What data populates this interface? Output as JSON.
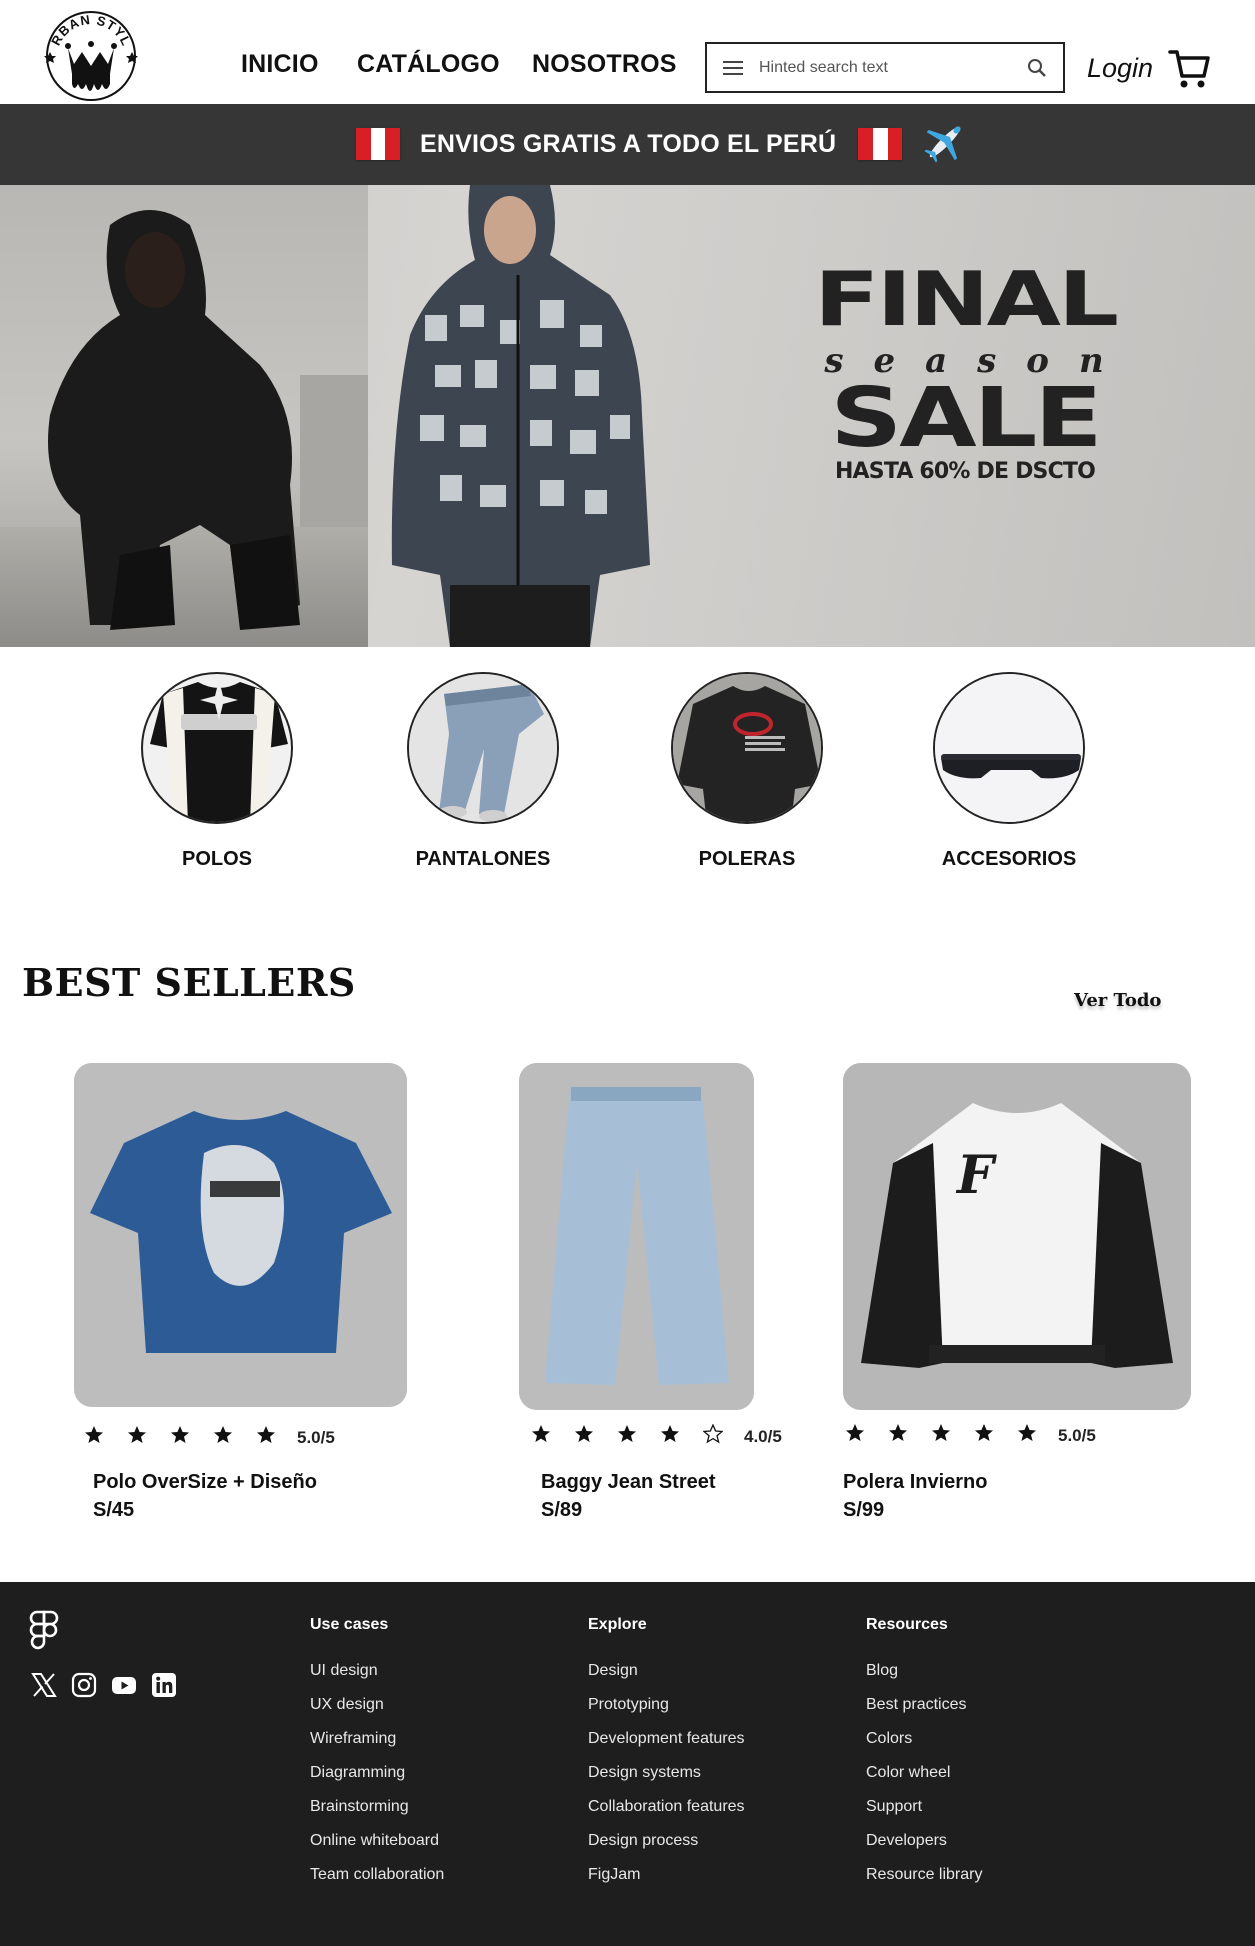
{
  "brand": {
    "logo_text": "URBAN STYLE"
  },
  "nav": {
    "items": [
      "INICIO",
      "CATÁLOGO",
      "NOSOTROS"
    ]
  },
  "search": {
    "placeholder": "Hinted search text",
    "value": ""
  },
  "header": {
    "login_label": "Login"
  },
  "promo": {
    "text": "ENVIOS GRATIS A TODO EL PERÚ"
  },
  "hero": {
    "line1": "FINAL",
    "line2": "season",
    "line3": "SALE",
    "line4": "HASTA 60% DE DSCTO"
  },
  "categories": [
    {
      "label": "POLOS"
    },
    {
      "label": "PANTALONES"
    },
    {
      "label": "POLERAS"
    },
    {
      "label": "ACCESORIOS"
    }
  ],
  "best_sellers": {
    "title": "BEST SELLERS",
    "view_all": "Ver Todo",
    "products": [
      {
        "name": "Polo OverSize + Diseño",
        "price": "S/45",
        "rating_text": "5.0/5",
        "rating": 5
      },
      {
        "name": "Baggy Jean Street",
        "price": "S/89",
        "rating_text": "4.0/5",
        "rating": 4
      },
      {
        "name": "Polera Invierno",
        "price": "S/99",
        "rating_text": "5.0/5",
        "rating": 5
      }
    ]
  },
  "footer": {
    "columns": [
      {
        "title": "Use cases",
        "links": [
          "UI design",
          "UX design",
          "Wireframing",
          "Diagramming",
          "Brainstorming",
          "Online whiteboard",
          "Team collaboration"
        ]
      },
      {
        "title": "Explore",
        "links": [
          "Design",
          "Prototyping",
          "Development features",
          "Design systems",
          "Collaboration features",
          "Design process",
          "FigJam"
        ]
      },
      {
        "title": "Resources",
        "links": [
          "Blog",
          "Best practices",
          "Colors",
          "Color wheel",
          "Support",
          "Developers",
          "Resource library"
        ]
      }
    ]
  },
  "colors": {
    "promo_bg": "#363636",
    "footer_bg": "#1e1e1e",
    "flag_red": "#d91f26",
    "text": "#111111"
  },
  "icons": [
    "menu-icon",
    "search-icon",
    "cart-icon",
    "flag-icon",
    "airplane-icon",
    "star-icon",
    "figma-icon",
    "x-icon",
    "instagram-icon",
    "youtube-icon",
    "linkedin-icon"
  ]
}
